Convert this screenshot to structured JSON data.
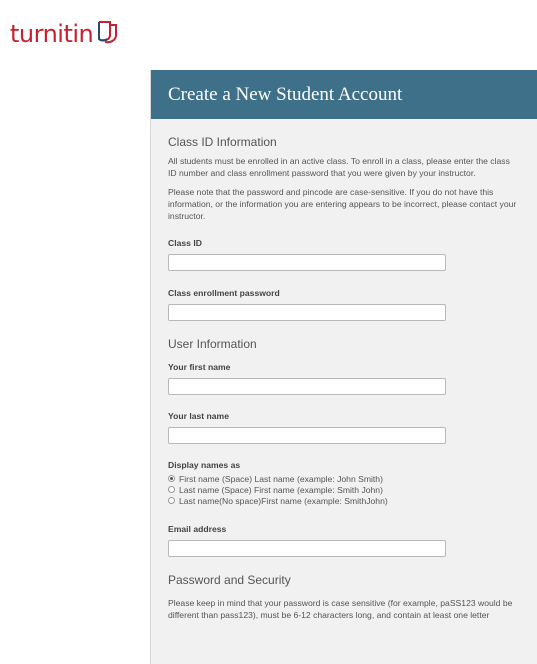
{
  "logo": {
    "text": "turnitin"
  },
  "header": {
    "title": "Create a New Student Account"
  },
  "class_section": {
    "title": "Class ID Information",
    "para1": "All students must be enrolled in an active class. To enroll in a class, please enter the class ID number and class enrollment password that you were given by your instructor.",
    "para2": "Please note that the password and pincode are case-sensitive. If you do not have this information, or the information you are entering appears to be incorrect, please contact your instructor.",
    "class_id_label": "Class ID",
    "class_id_value": "",
    "enroll_pw_label": "Class enrollment password",
    "enroll_pw_value": ""
  },
  "user_section": {
    "title": "User Information",
    "first_name_label": "Your first name",
    "first_name_value": "",
    "last_name_label": "Your last name",
    "last_name_value": "",
    "display_label": "Display names as",
    "display_options": [
      {
        "label": "First name (Space) Last name (example: John Smith)",
        "checked": true
      },
      {
        "label": "Last name (Space) First name (example: Smith John)",
        "checked": false
      },
      {
        "label": "Last name(No space)First name (example: SmithJohn)",
        "checked": false
      }
    ],
    "email_label": "Email address",
    "email_value": ""
  },
  "password_section": {
    "title": "Password and Security",
    "para": "Please keep in mind that your password is case sensitive (for example, paSS123 would be different than pass123), must be 6-12 characters long, and contain at least one letter"
  },
  "colors": {
    "header_bg": "#3f7089",
    "brand_red": "#c8202f",
    "panel_bg": "#f1f1f1"
  }
}
